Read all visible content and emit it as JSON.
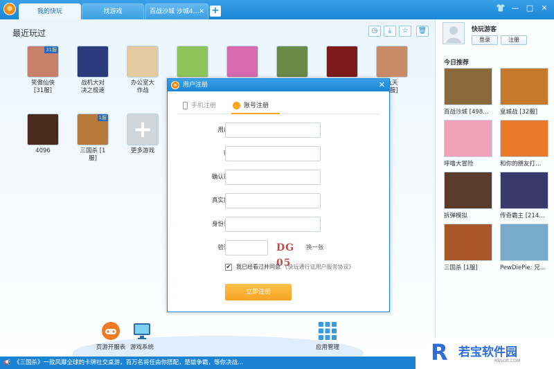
{
  "tabs": [
    {
      "label": "我的快玩",
      "active": true
    },
    {
      "label": "找游戏",
      "active": false
    },
    {
      "label": "百战沙城  沙城4…",
      "active": false
    }
  ],
  "window_controls": {
    "minimize": "—",
    "maximize": "□",
    "close": "✕"
  },
  "main": {
    "section_title": "最近玩过",
    "toolbar_icons": [
      "clock-icon",
      "download-icon",
      "star-icon",
      "trash-icon"
    ],
    "games": [
      {
        "name": "笑傲仙侠\n[31服]",
        "badge": "31服",
        "color": "#c9806a"
      },
      {
        "name": "战机大对\n决之极速",
        "badge": "",
        "color": "#2b3a7a"
      },
      {
        "name": "办公室大\n作战",
        "badge": "",
        "color": "#e2c9a0"
      },
      {
        "name": "",
        "badge": "",
        "color": "#8fc45a"
      },
      {
        "name": "",
        "badge": "",
        "color": "#d86ab0"
      },
      {
        "name": "",
        "badge": "",
        "color": "#6a8a4a"
      },
      {
        "name": "",
        "badge": "",
        "color": "#7a1a1a"
      },
      {
        "name": "九天\n9服]",
        "badge": "",
        "color": "#c98a6a"
      },
      {
        "name": "4096",
        "badge": "",
        "color": "#4a2a1a"
      },
      {
        "name": "三国杀 [1\n服]",
        "badge": "1服",
        "color": "#b87a3a"
      },
      {
        "name": "更多游戏",
        "badge": "",
        "color": "#cfd6dc"
      }
    ]
  },
  "dock": {
    "items": [
      {
        "label": "页游开服表",
        "icon": "gamepad-icon"
      },
      {
        "label": "游戏系统",
        "icon": "monitor-icon"
      },
      {
        "label": "应用管理",
        "icon": "apps-grid-icon"
      }
    ]
  },
  "statusbar": {
    "text": "《三国杀》一款风靡全球的卡牌社交桌游，百万名将任由你搭配，楚雄争霸，等你决战..."
  },
  "sidebar": {
    "username": "快玩游客",
    "login_label": "登录",
    "register_label": "注册",
    "today_title": "今日推荐",
    "recommendations": [
      {
        "name": "百战沙城 [498…",
        "color": "#8a6a3a"
      },
      {
        "name": "皇城战 [32服]",
        "color": "#c47a2a"
      },
      {
        "name": "呼噜大冒险",
        "color": "#f0a0b8"
      },
      {
        "name": "和你的朋友打…",
        "color": "#ea7a2a"
      },
      {
        "name": "拆弹模拟",
        "color": "#5a3a2a"
      },
      {
        "name": "传奇霸主 [214…",
        "color": "#3a3a6a"
      },
      {
        "name": "三国杀 [1服]",
        "color": "#a8562a"
      },
      {
        "name": "PewDiePie: 兄…",
        "color": "#7aaacb"
      }
    ]
  },
  "dialog": {
    "title": "用户注册",
    "tab_phone": "手机注册",
    "tab_account": "账号注册",
    "fields": [
      {
        "label": "用户名",
        "value": ""
      },
      {
        "label": "密码",
        "value": ""
      },
      {
        "label": "确认密码",
        "value": ""
      },
      {
        "label": "真实姓名",
        "value": ""
      },
      {
        "label": "身份证号",
        "value": ""
      },
      {
        "label": "验证码",
        "value": ""
      }
    ],
    "captcha_text": "DG 05",
    "captcha_refresh": "换一张",
    "agree_text": "我已经看过并同意",
    "agree_link": "《快玩通行证用户服务协议》",
    "agree_checked": true,
    "submit_label": "立即注册"
  },
  "watermark": {
    "text": "若宝软件园",
    "sub": "RBSOft.COM"
  }
}
